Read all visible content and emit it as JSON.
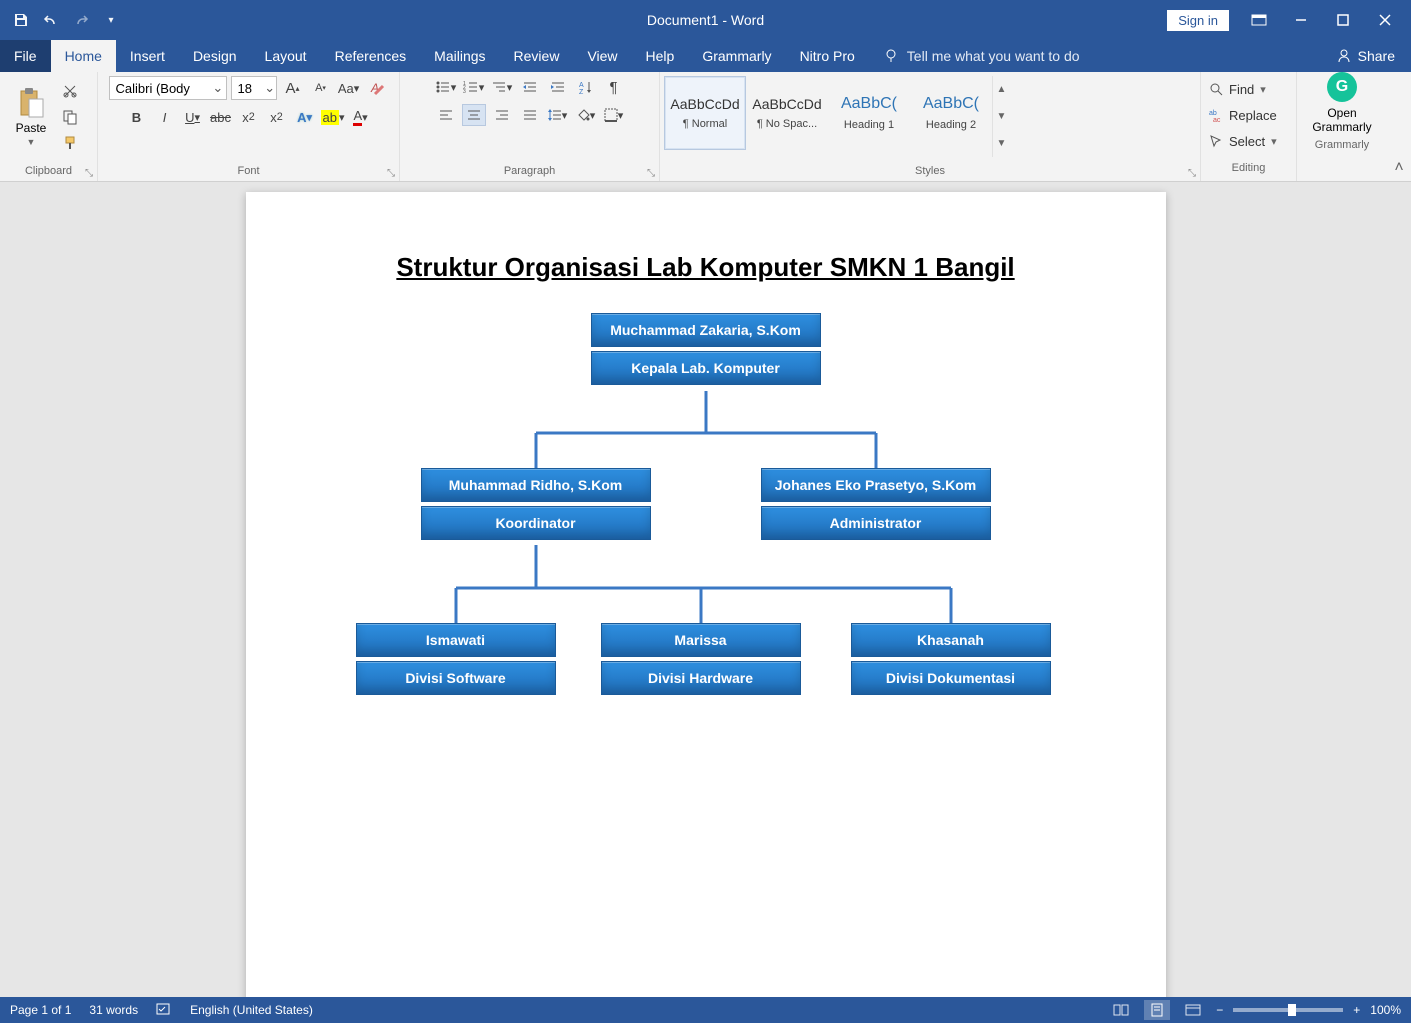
{
  "titlebar": {
    "document_title": "Document1 - Word",
    "signin": "Sign in"
  },
  "tabs": {
    "file": "File",
    "home": "Home",
    "insert": "Insert",
    "design": "Design",
    "layout": "Layout",
    "references": "References",
    "mailings": "Mailings",
    "review": "Review",
    "view": "View",
    "help": "Help",
    "grammarly": "Grammarly",
    "nitro": "Nitro Pro",
    "tellme": "Tell me what you want to do",
    "share": "Share"
  },
  "ribbon": {
    "clipboard": {
      "label": "Clipboard",
      "paste": "Paste"
    },
    "font": {
      "label": "Font",
      "name_value": "Calibri (Body",
      "size_value": "18"
    },
    "paragraph": {
      "label": "Paragraph"
    },
    "styles": {
      "label": "Styles",
      "preview": "AaBbCcDd",
      "preview_h": "AaBbC(",
      "normal": "¶ Normal",
      "nospace": "¶ No Spac...",
      "h1": "Heading 1",
      "h2": "Heading 2"
    },
    "editing": {
      "label": "Editing",
      "find": "Find",
      "replace": "Replace",
      "select": "Select"
    },
    "grammarly": {
      "label": "Grammarly",
      "open1": "Open",
      "open2": "Grammarly"
    }
  },
  "document": {
    "title": "Struktur Organisasi Lab Komputer SMKN 1 Bangil",
    "org": {
      "top": {
        "name": "Muchammad Zakaria, S.Kom",
        "role": "Kepala Lab. Komputer"
      },
      "mid_left": {
        "name": "Muhammad Ridho, S.Kom",
        "role": "Koordinator"
      },
      "mid_right": {
        "name": "Johanes Eko Prasetyo, S.Kom",
        "role": "Administrator"
      },
      "bot_left": {
        "name": "Ismawati",
        "role": "Divisi Software"
      },
      "bot_mid": {
        "name": "Marissa",
        "role": "Divisi Hardware"
      },
      "bot_right": {
        "name": "Khasanah",
        "role": "Divisi Dokumentasi"
      }
    }
  },
  "statusbar": {
    "page": "Page 1 of 1",
    "words": "31 words",
    "lang": "English (United States)",
    "zoom": "100%"
  }
}
